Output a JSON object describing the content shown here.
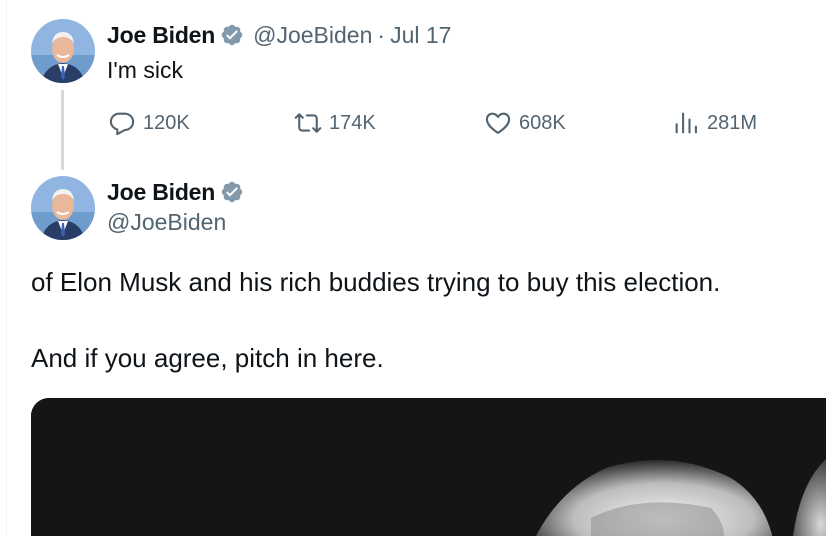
{
  "colors": {
    "text_primary": "#0f1419",
    "text_secondary": "#536471",
    "verified_badge": "#829aab",
    "thread_line": "#cfd9de",
    "media_background": "#151515"
  },
  "tweet_1": {
    "author_name": "Joe Biden",
    "handle": "@JoeBiden",
    "separator": "·",
    "date": "Jul 17",
    "text": "I'm sick",
    "avatar_icon": "profile-photo",
    "verified_icon": "verified-badge-icon",
    "actions": {
      "reply": {
        "icon": "reply-icon",
        "count": "120K"
      },
      "retweet": {
        "icon": "retweet-icon",
        "count": "174K"
      },
      "like": {
        "icon": "heart-icon",
        "count": "608K"
      },
      "views": {
        "icon": "views-icon",
        "count": "281M"
      }
    }
  },
  "tweet_2": {
    "author_name": "Joe Biden",
    "handle": "@JoeBiden",
    "avatar_icon": "profile-photo",
    "verified_icon": "verified-badge-icon",
    "text_line_1": "of Elon Musk and his rich buddies trying to buy this election.",
    "text_line_2": "And if you agree, pitch in here.",
    "media_kind": "black-and-white photo"
  }
}
